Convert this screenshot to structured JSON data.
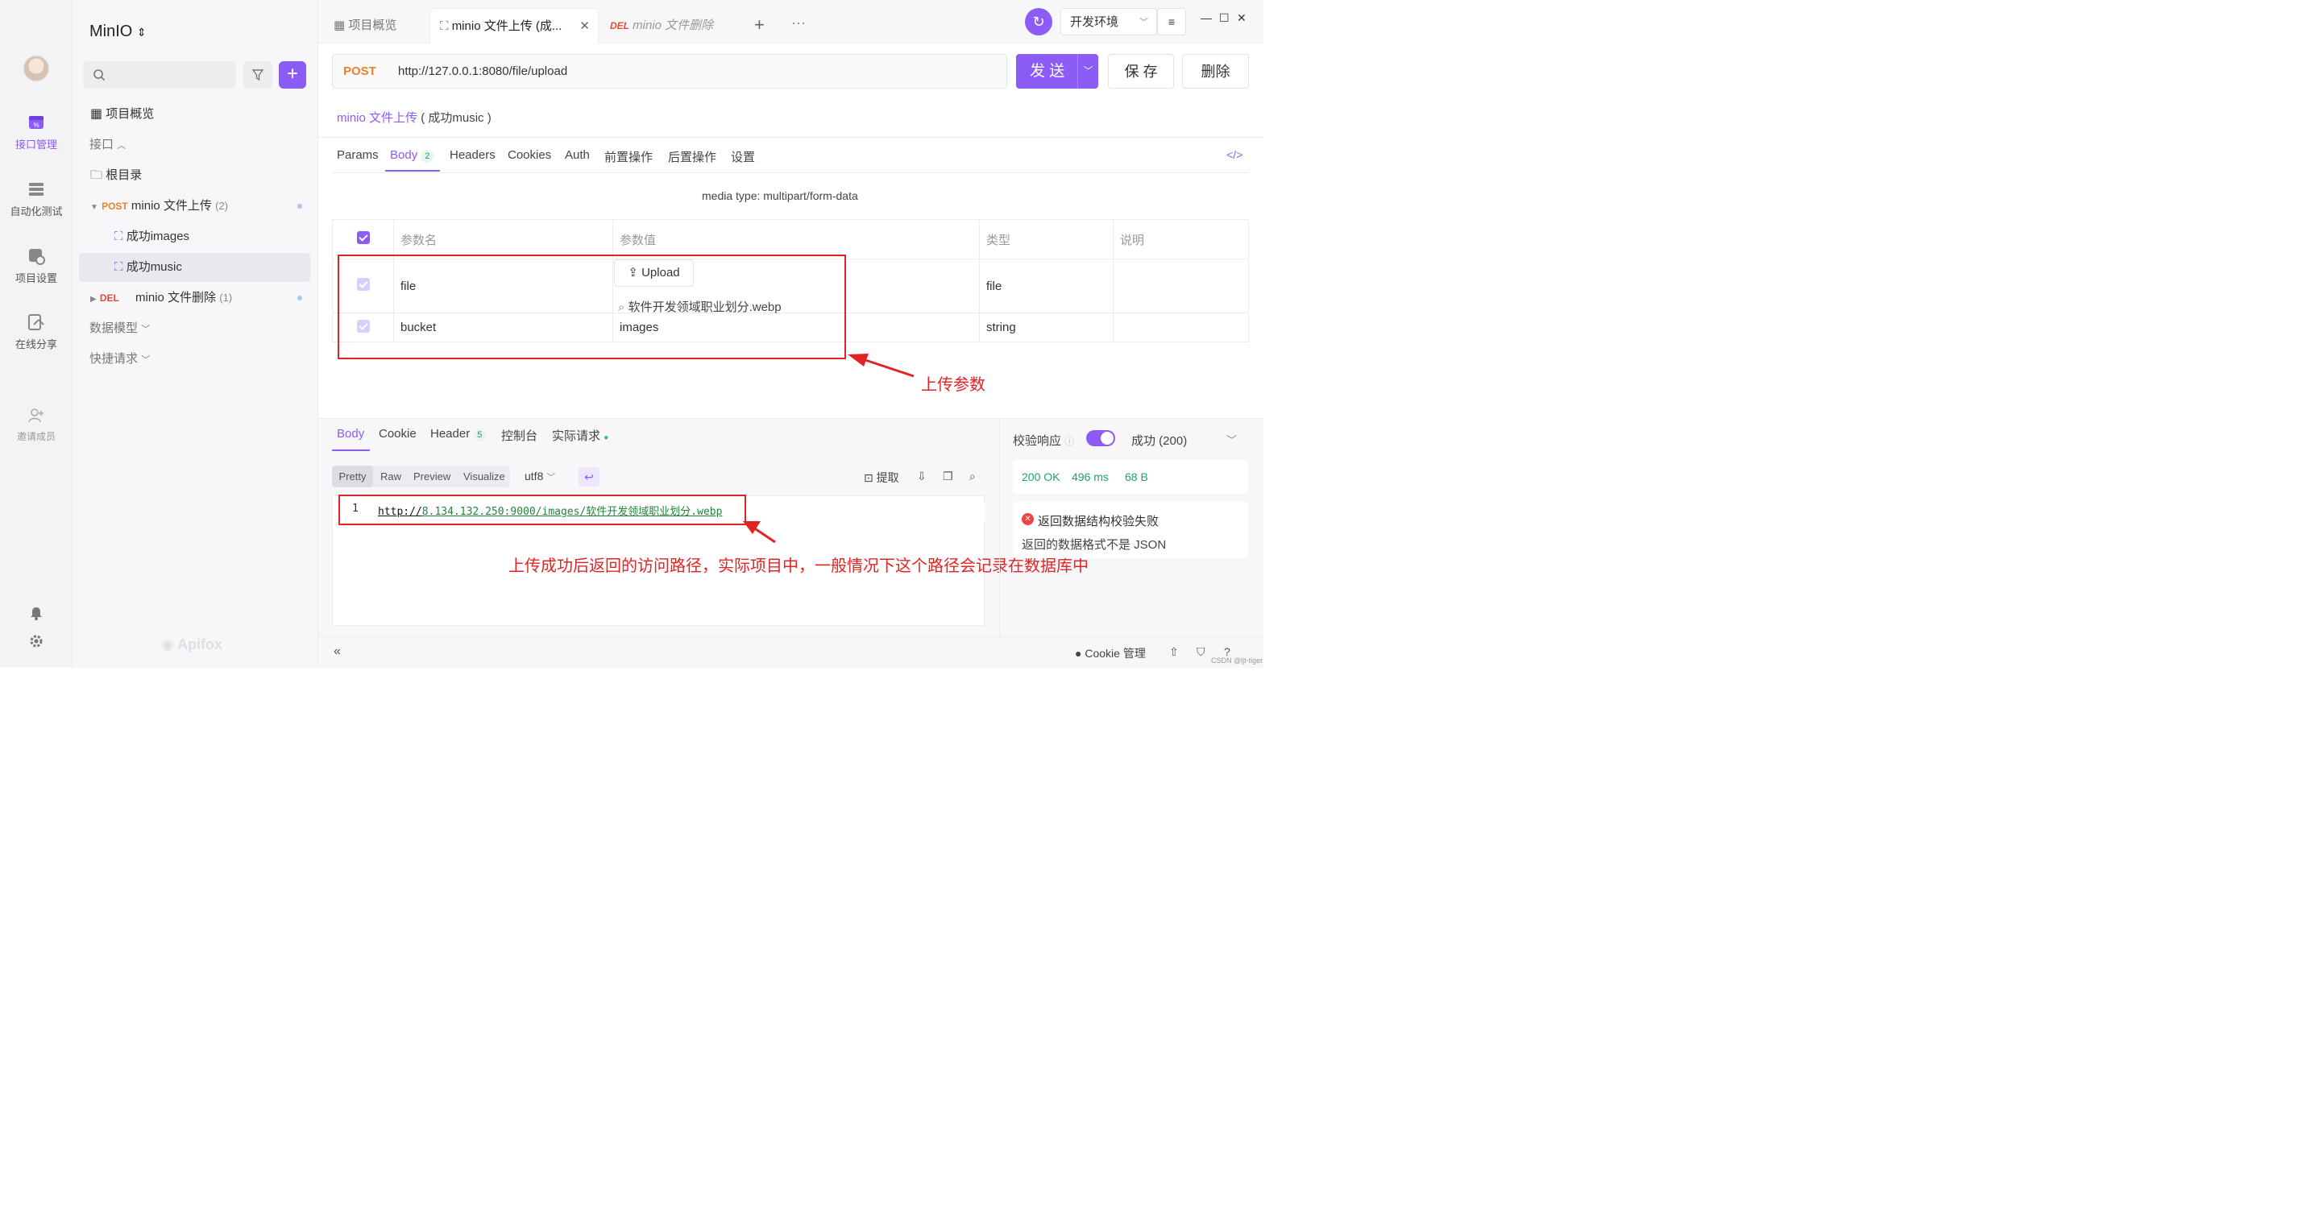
{
  "rail": {
    "items": [
      {
        "label": "接口管理"
      },
      {
        "label": "自动化测试"
      },
      {
        "label": "项目设置"
      },
      {
        "label": "在线分享"
      },
      {
        "label": "邀请成员"
      }
    ]
  },
  "sidebar": {
    "project_name": "MinIO",
    "overview": "项目概览",
    "api_section": "接口",
    "root": "根目录",
    "tree": [
      {
        "method": "POST",
        "name": "minio 文件上传",
        "count": "(2)"
      },
      {
        "name": "成功images"
      },
      {
        "name": "成功music"
      },
      {
        "method": "DEL",
        "name": "minio 文件删除",
        "count": "(1)"
      }
    ],
    "data_model": "数据模型",
    "quick_request": "快捷请求",
    "watermark": "Apifox"
  },
  "tabs": [
    {
      "label": "项目概览"
    },
    {
      "label": "minio 文件上传 (成..."
    },
    {
      "method": "DEL",
      "label": "minio 文件删除"
    }
  ],
  "header_right": {
    "env": "开发环境"
  },
  "request": {
    "method": "POST",
    "url": "http://127.0.0.1:8080/file/upload",
    "send": "发 送",
    "save": "保 存",
    "delete": "删除",
    "breadcrumb_link": "minio 文件上传",
    "breadcrumb_suffix": "( 成功music )",
    "subtabs": [
      "Params",
      "Body",
      "Headers",
      "Cookies",
      "Auth",
      "前置操作",
      "后置操作",
      "设置"
    ],
    "body_count": "2",
    "media_type": "media type: multipart/form-data",
    "columns": [
      "参数名",
      "参数值",
      "类型",
      "说明"
    ],
    "rows": [
      {
        "name": "file",
        "upload": "Upload",
        "file_name": "软件开发领域职业划分.webp",
        "type": "file"
      },
      {
        "name": "bucket",
        "value": "images",
        "type": "string"
      }
    ],
    "annotation": "上传参数"
  },
  "response": {
    "tabs": [
      "Body",
      "Cookie",
      "Header",
      "控制台",
      "实际请求"
    ],
    "header_count": "5",
    "views": [
      "Pretty",
      "Raw",
      "Preview",
      "Visualize"
    ],
    "encoding": "utf8",
    "extract": "提取",
    "line_no": "1",
    "url_link": "http://",
    "url_rest": "8.134.132.250:9000/images/软件开发领域职业划分.webp",
    "annotation": "上传成功后返回的访问路径，实际项目中，一般情况下这个路径会记录在数据库中",
    "validate_label": "校验响应",
    "status_select": "成功 (200)",
    "status": "200 OK",
    "time": "496 ms",
    "size": "68 B",
    "fail_title": "返回数据结构校验失败",
    "fail_detail": "返回的数据格式不是 JSON"
  },
  "footer": {
    "cookie": "Cookie 管理",
    "credit": "CSDN @ljt-tiger"
  }
}
